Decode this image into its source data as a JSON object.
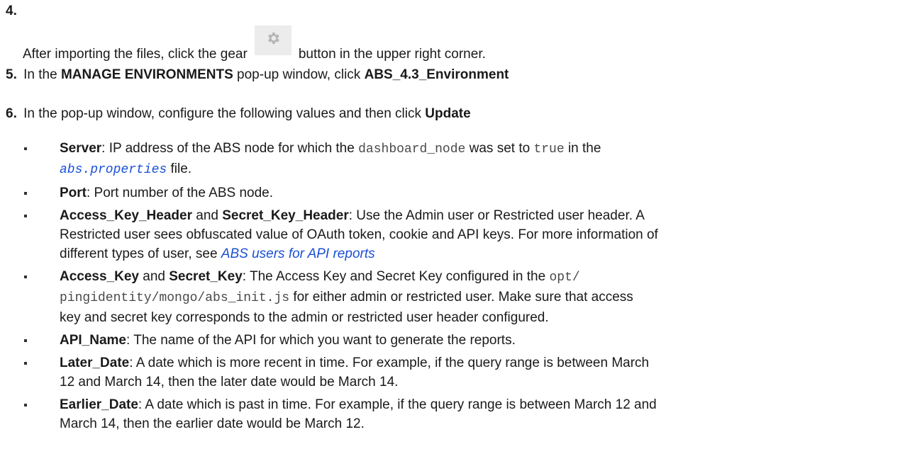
{
  "step4": {
    "num": "4.",
    "pre": "After importing the files, click the gear",
    "post": "button in the upper right corner.",
    "gear_icon": "gear-icon"
  },
  "step5": {
    "num": "5.",
    "pre": "In the",
    "b1": "MANAGE ENVIRONMENTS",
    "mid": "pop-up window, click",
    "b2": "ABS_4.3_Environment"
  },
  "step6": {
    "num": "6.",
    "pre": "In the pop-up window, configure the following values and then click",
    "b1": "Update"
  },
  "bullets": {
    "server": {
      "label": "Server",
      "t1": ": IP address of the ABS node for which the ",
      "code1": "dashboard_node",
      "t2": " was set to ",
      "code2": "true",
      "t3": " in the",
      "link": "abs.properties",
      "t4": " file."
    },
    "port": {
      "label": "Port",
      "t1": ": Port number of the ABS node."
    },
    "headers": {
      "label1": "Access_Key_Header",
      "and": " and ",
      "label2": "Secret_Key_Header",
      "t1": ": Use the Admin user or Restricted user header. A",
      "t2": "Restricted user sees obfuscated value of OAuth token, cookie and API keys. For more information of",
      "t3": "different types of user, see ",
      "link": "ABS users for API reports"
    },
    "keys": {
      "label1": "Access_Key",
      "and": " and ",
      "label2": "Secret_Key",
      "t1": ": The Access Key and Secret Key configured in the ",
      "code1": "opt/",
      "code2": "pingidentity/mongo/abs_init.js",
      "t2": " for either admin or restricted user. Make sure that access",
      "t3": "key and secret key corresponds to the admin or restricted user header configured."
    },
    "api": {
      "label": "API_Name",
      "t1": ": The name of the API for which you want to generate the reports."
    },
    "later": {
      "label": "Later_Date",
      "t1": ": A date which is more recent in time. For example, if the query range is between March",
      "t2": "12 and March 14, then the later date would be March 14."
    },
    "earlier": {
      "label": "Earlier_Date",
      "t1": ": A date which is past in time. For example, if the query range is between March 12 and",
      "t2": "March 14, then the earlier date would be March 12."
    }
  }
}
